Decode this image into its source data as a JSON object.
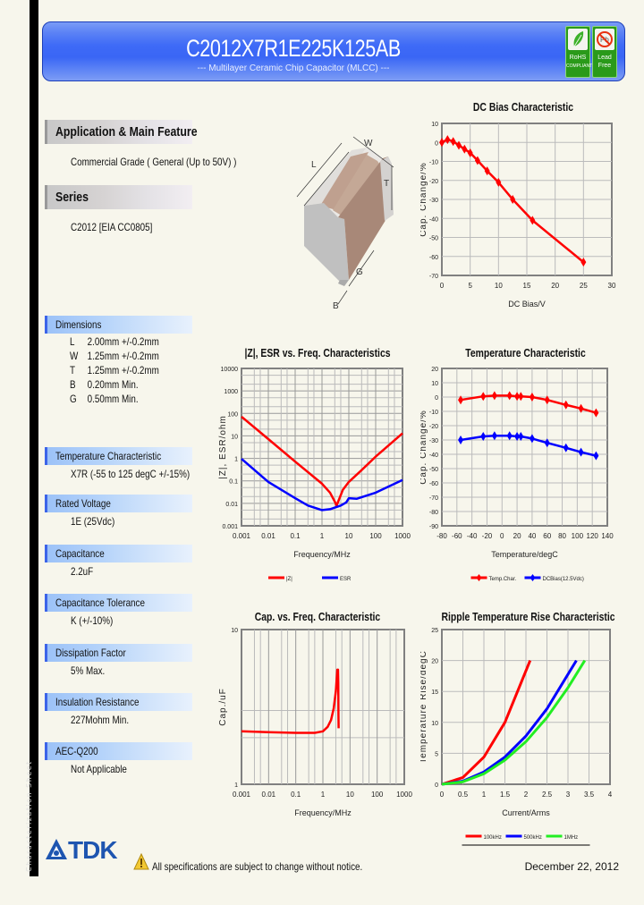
{
  "header": {
    "title": "C2012X7R1E225K125AB",
    "subtitle": "--- Multilayer Ceramic Chip Capacitor (MLCC) ---",
    "badges": [
      {
        "icon": "leaf-icon",
        "label_line1": "RoHS",
        "label_line2": "COMPLIANT"
      },
      {
        "icon": "no-lead-icon",
        "label_line1": "Lead",
        "label_line2": "Free"
      }
    ]
  },
  "sidebar_label": "Characterization Sheet",
  "sections": {
    "application": {
      "title": "Application & Main Feature",
      "value": "Commercial Grade ( General (Up to 50V) )"
    },
    "series": {
      "title": "Series",
      "value": "C2012 [EIA CC0805]"
    },
    "dimensions": {
      "title": "Dimensions",
      "rows": [
        {
          "key": "L",
          "value": "2.00mm +/-0.2mm"
        },
        {
          "key": "W",
          "value": "1.25mm +/-0.2mm"
        },
        {
          "key": "T",
          "value": "1.25mm +/-0.2mm"
        },
        {
          "key": "B",
          "value": "0.20mm Min."
        },
        {
          "key": "G",
          "value": "0.50mm Min."
        }
      ]
    },
    "temperature": {
      "title": "Temperature Characteristic",
      "value": "X7R (-55 to 125 degC +/-15%)"
    },
    "rated_voltage": {
      "title": "Rated Voltage",
      "value": "1E (25Vdc)"
    },
    "capacitance": {
      "title": "Capacitance",
      "value": "2.2uF"
    },
    "tolerance": {
      "title": "Capacitance Tolerance",
      "value": "K (+/-10%)"
    },
    "dissipation": {
      "title": "Dissipation Factor",
      "value": "5% Max."
    },
    "insulation": {
      "title": "Insulation Resistance",
      "value": "227Mohm Min."
    },
    "aec": {
      "title": "AEC-Q200",
      "value": "Not Applicable"
    }
  },
  "diagram_labels": {
    "L": "L",
    "W": "W",
    "T": "T",
    "G": "G",
    "B": "B"
  },
  "footer": {
    "brand": "TDK",
    "note": "All specifications are subject to change without notice.",
    "date": "December 22, 2012"
  },
  "chart_data": [
    {
      "id": "dc_bias",
      "type": "line",
      "title": "DC Bias Characteristic",
      "xlabel": "DC Bias/V",
      "ylabel": "Cap. Change/%",
      "xlim": [
        0,
        30
      ],
      "ylim": [
        -70,
        10
      ],
      "xticks": [
        "0",
        "5",
        "10",
        "15",
        "20",
        "25",
        "30"
      ],
      "yticks": [
        "10",
        "0",
        "-10",
        "-20",
        "-30",
        "-40",
        "-50",
        "-60",
        "-70"
      ],
      "grid": true,
      "series": [
        {
          "name": "DC Bias",
          "color": "#ff0000",
          "x": [
            0,
            1,
            2,
            3,
            4,
            5,
            6.3,
            8,
            10,
            12.5,
            16,
            25
          ],
          "y": [
            0,
            1.5,
            0.5,
            -1.5,
            -3.5,
            -5.5,
            -9.5,
            -15,
            -21,
            -30,
            -41,
            -63
          ]
        }
      ]
    },
    {
      "id": "impedance",
      "type": "line",
      "title": "|Z|, ESR vs. Freq. Characteristics",
      "xlabel": "Frequency/MHz",
      "ylabel": "|Z|, ESR/ohm",
      "xscale": "log",
      "yscale": "log",
      "xlim": [
        0.001,
        1000
      ],
      "ylim": [
        0.001,
        10000
      ],
      "xticks": [
        "0.001",
        "0.01",
        "0.1",
        "1",
        "10",
        "100",
        "1000"
      ],
      "yticks": [
        "10000",
        "1000",
        "100",
        "10",
        "1",
        "0.1",
        "0.01",
        "0.001"
      ],
      "grid": true,
      "legend": "bottom",
      "series": [
        {
          "name": "|Z|",
          "color": "#ff0000",
          "x": [
            0.001,
            0.01,
            0.1,
            1,
            2,
            3,
            3.5,
            4,
            6,
            10,
            30,
            100,
            1000
          ],
          "y": [
            72,
            7.2,
            0.72,
            0.075,
            0.03,
            0.012,
            0.008,
            0.012,
            0.04,
            0.09,
            0.3,
            1.2,
            13
          ]
        },
        {
          "name": "ESR",
          "color": "#0000ff",
          "x": [
            0.001,
            0.01,
            0.1,
            0.3,
            1,
            2,
            5,
            8,
            10,
            20,
            100,
            1000
          ],
          "y": [
            0.95,
            0.09,
            0.017,
            0.008,
            0.005,
            0.0055,
            0.008,
            0.011,
            0.017,
            0.016,
            0.03,
            0.11
          ]
        }
      ]
    },
    {
      "id": "temperature",
      "type": "line",
      "title": "Temperature Characteristic",
      "xlabel": "Temperature/degC",
      "ylabel": "Cap. Change/%",
      "xlim": [
        -80,
        140
      ],
      "ylim": [
        -90,
        20
      ],
      "xticks": [
        "-80",
        "-60",
        "-40",
        "-20",
        "0",
        "20",
        "40",
        "60",
        "80",
        "100",
        "120",
        "140"
      ],
      "yticks": [
        "20",
        "10",
        "0",
        "-10",
        "-20",
        "-30",
        "-40",
        "-50",
        "-60",
        "-70",
        "-80",
        "-90"
      ],
      "grid": true,
      "legend": "bottom",
      "series": [
        {
          "name": "Temp.Char.",
          "color": "#ff0000",
          "x": [
            -55,
            -25,
            -10,
            10,
            20,
            25,
            40,
            60,
            85,
            105,
            125
          ],
          "y": [
            -2,
            0.5,
            1,
            1,
            0.5,
            0.5,
            0,
            -2,
            -5.5,
            -8,
            -11
          ]
        },
        {
          "name": "DCBias(12.5Vdc)",
          "color": "#0000ff",
          "x": [
            -55,
            -25,
            -10,
            10,
            20,
            25,
            40,
            60,
            85,
            105,
            125
          ],
          "y": [
            -30,
            -27.5,
            -27,
            -27,
            -27.5,
            -27.5,
            -29,
            -32,
            -35.5,
            -38.5,
            -41
          ]
        }
      ]
    },
    {
      "id": "cap_freq",
      "type": "line",
      "title": "Cap. vs. Freq. Characteristic",
      "xlabel": "Frequency/MHz",
      "ylabel": "Cap./uF",
      "xscale": "log",
      "yscale": "log",
      "xlim": [
        0.001,
        1000
      ],
      "ylim": [
        1,
        10
      ],
      "xticks": [
        "0.001",
        "0.01",
        "0.1",
        "1",
        "10",
        "100",
        "1000"
      ],
      "yticks": [
        "10",
        "1"
      ],
      "grid": true,
      "series": [
        {
          "name": "Cap",
          "color": "#ff0000",
          "x": [
            0.001,
            0.01,
            0.1,
            0.5,
            1,
            1.5,
            2,
            2.5,
            3,
            3.4,
            3.6,
            3.7,
            3.75,
            3.8
          ],
          "y": [
            2.2,
            2.17,
            2.15,
            2.15,
            2.2,
            2.35,
            2.6,
            3.1,
            4.0,
            5.5,
            5.5,
            4.5,
            2.8,
            2.3
          ]
        }
      ]
    },
    {
      "id": "ripple",
      "type": "line",
      "title": "Ripple Temperature Rise Characteristic",
      "xlabel": "Current/Arms",
      "ylabel": "Temperature Rise/degC",
      "xlim": [
        0,
        4
      ],
      "ylim": [
        0,
        25
      ],
      "xticks": [
        "0",
        "0.5",
        "1",
        "1.5",
        "2",
        "2.5",
        "3",
        "3.5",
        "4"
      ],
      "yticks": [
        "25",
        "20",
        "15",
        "10",
        "5",
        "0"
      ],
      "grid": true,
      "legend": "bottom",
      "series": [
        {
          "name": "100kHz",
          "color": "#ff0000",
          "x": [
            0,
            0.5,
            1,
            1.5,
            2.1
          ],
          "y": [
            0,
            1.1,
            4.4,
            10,
            20
          ]
        },
        {
          "name": "500kHz",
          "color": "#0000ff",
          "x": [
            0,
            0.5,
            1,
            1.5,
            2,
            2.5,
            3.2
          ],
          "y": [
            0,
            0.5,
            2,
            4.4,
            7.8,
            12.2,
            20
          ]
        },
        {
          "name": "1MHz",
          "color": "#22ee22",
          "x": [
            0,
            0.5,
            1,
            1.5,
            2,
            2.5,
            3,
            3.4
          ],
          "y": [
            0,
            0.4,
            1.7,
            3.9,
            6.9,
            10.8,
            15.6,
            20
          ]
        }
      ]
    }
  ]
}
